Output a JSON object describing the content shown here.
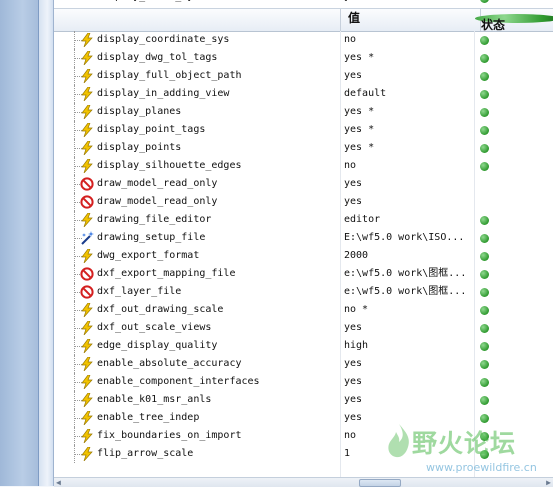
{
  "columns": {
    "value": "值",
    "status": "状态"
  },
  "partial_top_row": {
    "name": "display_error_sym",
    "value": "yes"
  },
  "rows": [
    {
      "icon": "lightning",
      "name": "display_coordinate_sys",
      "value": "no",
      "status": true
    },
    {
      "icon": "lightning",
      "name": "display_dwg_tol_tags",
      "value": "yes *",
      "status": true
    },
    {
      "icon": "lightning",
      "name": "display_full_object_path",
      "value": "yes",
      "status": true
    },
    {
      "icon": "lightning",
      "name": "display_in_adding_view",
      "value": "default",
      "status": true
    },
    {
      "icon": "lightning",
      "name": "display_planes",
      "value": "yes *",
      "status": true
    },
    {
      "icon": "lightning",
      "name": "display_point_tags",
      "value": "yes *",
      "status": true
    },
    {
      "icon": "lightning",
      "name": "display_points",
      "value": "yes *",
      "status": true
    },
    {
      "icon": "lightning",
      "name": "display_silhouette_edges",
      "value": "no",
      "status": true
    },
    {
      "icon": "prohibited",
      "name": "draw_model_read_only",
      "value": "yes",
      "status": false
    },
    {
      "icon": "prohibited",
      "name": "draw_model_read_only",
      "value": "yes",
      "status": false
    },
    {
      "icon": "lightning",
      "name": "drawing_file_editor",
      "value": "editor",
      "status": true
    },
    {
      "icon": "wand",
      "name": "drawing_setup_file",
      "value": "E:\\wf5.0 work\\ISO...",
      "status": true
    },
    {
      "icon": "lightning",
      "name": "dwg_export_format",
      "value": "2000",
      "status": true
    },
    {
      "icon": "prohibited",
      "name": "dxf_export_mapping_file",
      "value": "e:\\wf5.0 work\\图框...",
      "status": true
    },
    {
      "icon": "prohibited",
      "name": "dxf_layer_file",
      "value": "e:\\wf5.0 work\\图框...",
      "status": true
    },
    {
      "icon": "lightning",
      "name": "dxf_out_drawing_scale",
      "value": "no *",
      "status": true
    },
    {
      "icon": "lightning",
      "name": "dxf_out_scale_views",
      "value": "yes",
      "status": true
    },
    {
      "icon": "lightning",
      "name": "edge_display_quality",
      "value": "high",
      "status": true
    },
    {
      "icon": "lightning",
      "name": "enable_absolute_accuracy",
      "value": "yes",
      "status": true
    },
    {
      "icon": "lightning",
      "name": "enable_component_interfaces",
      "value": "yes",
      "status": true
    },
    {
      "icon": "lightning",
      "name": "enable_k01_msr_anls",
      "value": "yes",
      "status": true
    },
    {
      "icon": "lightning",
      "name": "enable_tree_indep",
      "value": "yes",
      "status": true
    },
    {
      "icon": "lightning",
      "name": "fix_boundaries_on_import",
      "value": "no",
      "status": true
    },
    {
      "icon": "lightning",
      "name": "flip_arrow_scale",
      "value": "1",
      "status": true
    }
  ],
  "watermark": {
    "text": "野火论坛",
    "url": "www.proewildfire.cn"
  },
  "colors": {
    "status_ok": "#2f9a2f",
    "lightning": "#f2c300",
    "prohibited": "#d42020"
  }
}
